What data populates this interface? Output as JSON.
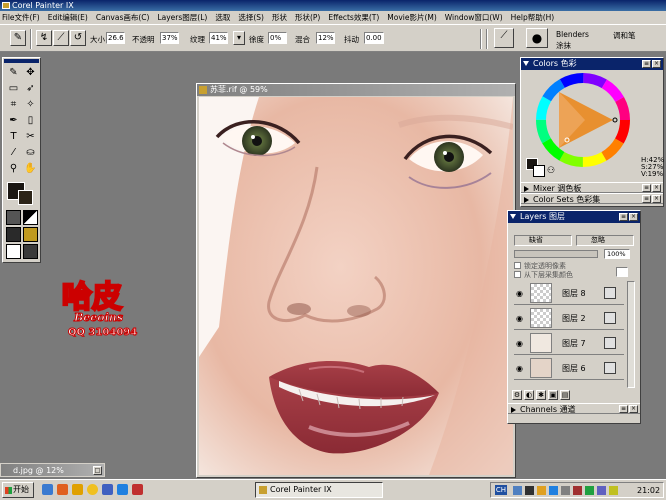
{
  "app": {
    "title": "Corel Painter IX"
  },
  "menu": [
    "File文件(F)",
    "Edit编辑(E)",
    "Canvas画布(C)",
    "Layers图层(L)",
    "选取",
    "选择(S)",
    "形状",
    "形状(P)",
    "Effects效果(T)",
    "Movie影片(M)",
    "Window窗口(W)",
    "Help帮助(H)"
  ],
  "property_bar": {
    "size_label": "大小",
    "size_value": "26.6",
    "opacity_label": "不透明",
    "opacity_value": "37%",
    "grain_label": "纹理",
    "grain_value": "41%",
    "bleed_label": "徐度",
    "bleed_value": "0%",
    "resat_label": "混合",
    "resat_value": "12%",
    "jitter_label": "抖动",
    "jitter_value": "0.00"
  },
  "brush_selector": {
    "category": "Blenders",
    "category_cn": "调和笔",
    "variant": "涂抹"
  },
  "document": {
    "title": "苏菲.rif @ 59%"
  },
  "minimized_document": {
    "title": "d.jpg @ 12%"
  },
  "colors_panel": {
    "title": "Colors",
    "title_cn": "色彩",
    "h": "H:42%",
    "s": "S:27%",
    "v": "V:19%",
    "primary_color": "#1a1612",
    "secondary_color": "#ffffff"
  },
  "collapsed_panels": [
    {
      "label": "Mixer",
      "label_cn": "调色板"
    },
    {
      "label": "Color Sets",
      "label_cn": "色彩集"
    }
  ],
  "layers_panel": {
    "title": "Layers",
    "title_cn": "图层",
    "composite_method": "缺省",
    "composite_depth": "忽略",
    "opacity_value": "100%",
    "pick_up_label": "锁定透明像素",
    "pick_up_label2": "从下层采集颜色",
    "layers": [
      "图层 8",
      "图层 2",
      "图层 7",
      "图层 6"
    ],
    "channels_label": "Channels",
    "channels_label_cn": "通道"
  },
  "taskbar": {
    "start_label": "开始",
    "task_item": "Corel Painter IX",
    "lang": "CH",
    "clock": "21:02"
  },
  "watermark": {
    "text": "哈皮",
    "sub": "Beeoins",
    "qq": "QQ 3104094"
  }
}
